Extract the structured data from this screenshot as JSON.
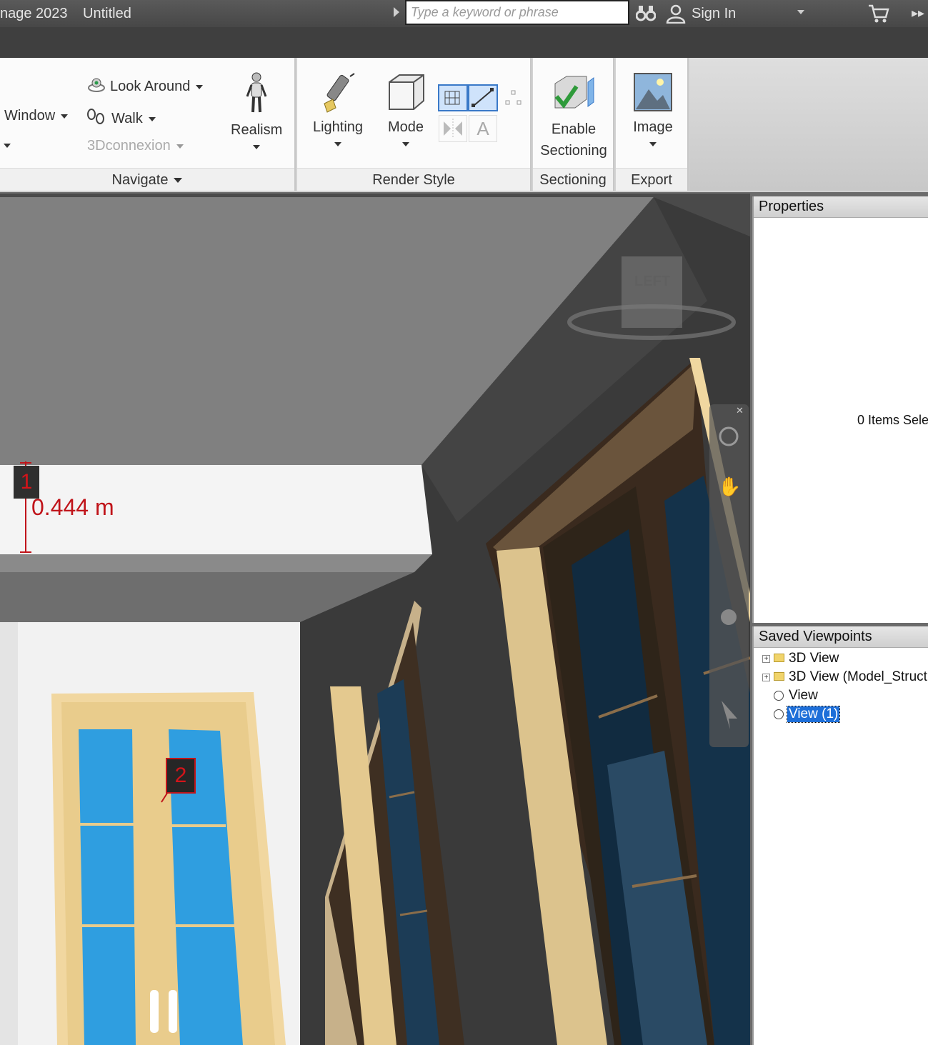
{
  "titlebar": {
    "app_title": "nage 2023",
    "doc_title": "Untitled",
    "search_placeholder": "Type a keyword or phrase",
    "sign_in": "Sign In"
  },
  "ribbon": {
    "navigate": {
      "window_label": "Window",
      "look_around_label": "Look Around",
      "walk_label": "Walk",
      "threedconnexion_label": "3Dconnexion",
      "realism_label": "Realism",
      "panel_label": "Navigate"
    },
    "render_style": {
      "lighting_label": "Lighting",
      "mode_label": "Mode",
      "panel_label": "Render Style"
    },
    "sectioning": {
      "enable_label_1": "Enable",
      "enable_label_2": "Sectioning",
      "panel_label": "Sectioning"
    },
    "export": {
      "image_label": "Image",
      "panel_label": "Export"
    }
  },
  "viewport": {
    "measurement": "0.444 m",
    "tag1": "1",
    "tag2": "2",
    "viewcube_face": "LEFT"
  },
  "properties": {
    "title": "Properties",
    "info": "0 Items Sele"
  },
  "saved_viewpoints": {
    "title": "Saved Viewpoints",
    "items": [
      {
        "label": "3D View"
      },
      {
        "label": "3D View (Model_Structu"
      },
      {
        "label": "View"
      },
      {
        "label": "View (1)"
      }
    ]
  }
}
